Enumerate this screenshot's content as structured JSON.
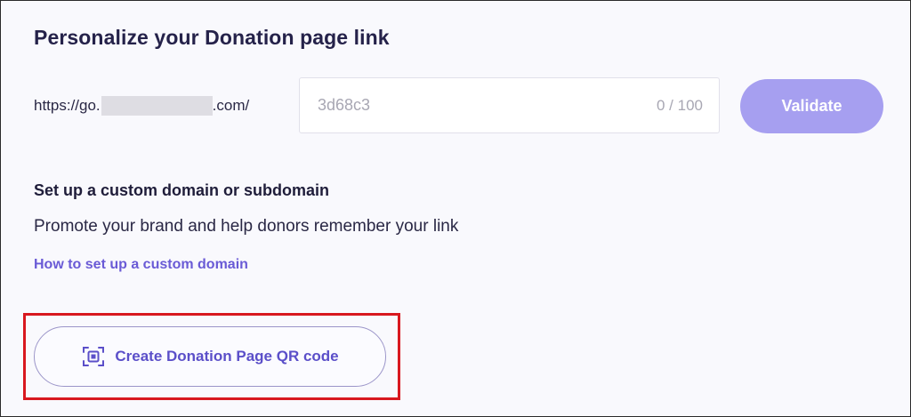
{
  "personalize": {
    "title": "Personalize your Donation page link",
    "url_prefix_start": "https://go.",
    "url_prefix_end": ".com/",
    "slug_placeholder": "3d68c3",
    "slug_value": "",
    "char_counter": "0 / 100",
    "validate_label": "Validate"
  },
  "custom_domain": {
    "heading": "Set up a custom domain or subdomain",
    "description": "Promote your brand and help donors remember your link",
    "help_link": "How to set up a custom domain"
  },
  "qr": {
    "button_label": "Create Donation Page QR code",
    "icon": "qr-scan-icon"
  },
  "colors": {
    "accent": "#5b4fc9",
    "validate_bg": "#a69ff0",
    "highlight": "#d8181f"
  }
}
